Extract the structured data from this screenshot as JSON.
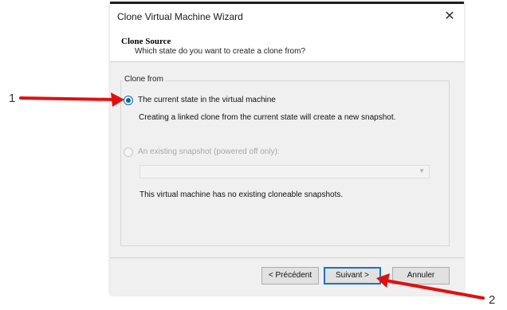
{
  "dialog": {
    "title": "Clone Virtual Machine Wizard",
    "close_glyph": "✕",
    "header_title": "Clone Source",
    "header_subtitle": "Which state do you want to create a clone from?"
  },
  "clone_from": {
    "group_label": "Clone from",
    "option_current_label": "The current state in the virtual machine",
    "option_current_selected": true,
    "option_current_desc": "Creating a linked clone from the current state will create a new snapshot.",
    "option_snapshot_label": "An existing snapshot (powered off only):",
    "option_snapshot_enabled": false,
    "snapshot_dropdown_value": "",
    "no_snapshots_text": "This virtual machine has no existing cloneable snapshots."
  },
  "buttons": {
    "prev_label": "< Précédent",
    "next_label": "Suivant >",
    "cancel_label": "Annuler"
  },
  "annotations": {
    "marker_1": "1",
    "marker_2": "2",
    "arrow_color": "#e01010"
  },
  "colors": {
    "accent": "#0a64ad",
    "dialog_bg": "#f0f0f0"
  },
  "icons": {
    "close": "close-icon",
    "dropdown": "chevron-down-icon"
  }
}
